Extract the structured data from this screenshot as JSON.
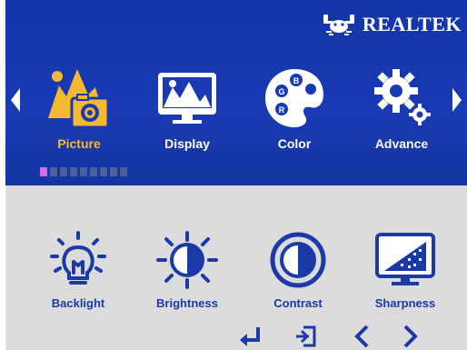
{
  "brand": {
    "name": "REALTEK"
  },
  "colors": {
    "panel_blue": "#1a3ab4",
    "active": "#f5b82e",
    "text_blue": "#1b3aa8",
    "sub_bg": "#dcdcdc",
    "pager_active": "#d86be0"
  },
  "menu": {
    "items": [
      {
        "label": "Picture",
        "icon": "picture-icon",
        "active": true
      },
      {
        "label": "Display",
        "icon": "display-icon",
        "active": false
      },
      {
        "label": "Color",
        "icon": "color-palette-icon",
        "active": false
      },
      {
        "label": "Advance",
        "icon": "gears-icon",
        "active": false
      }
    ],
    "pager": {
      "current": 1,
      "total": 9
    }
  },
  "submenu": {
    "items": [
      {
        "label": "Backlight",
        "icon": "lightbulb-icon"
      },
      {
        "label": "Brightness",
        "icon": "sun-icon"
      },
      {
        "label": "Contrast",
        "icon": "contrast-icon"
      },
      {
        "label": "Sharpness",
        "icon": "sharpness-icon"
      }
    ]
  },
  "navigation": {
    "keys": [
      "enter-icon",
      "exit-icon",
      "chevron-left-icon",
      "chevron-right-icon"
    ]
  }
}
